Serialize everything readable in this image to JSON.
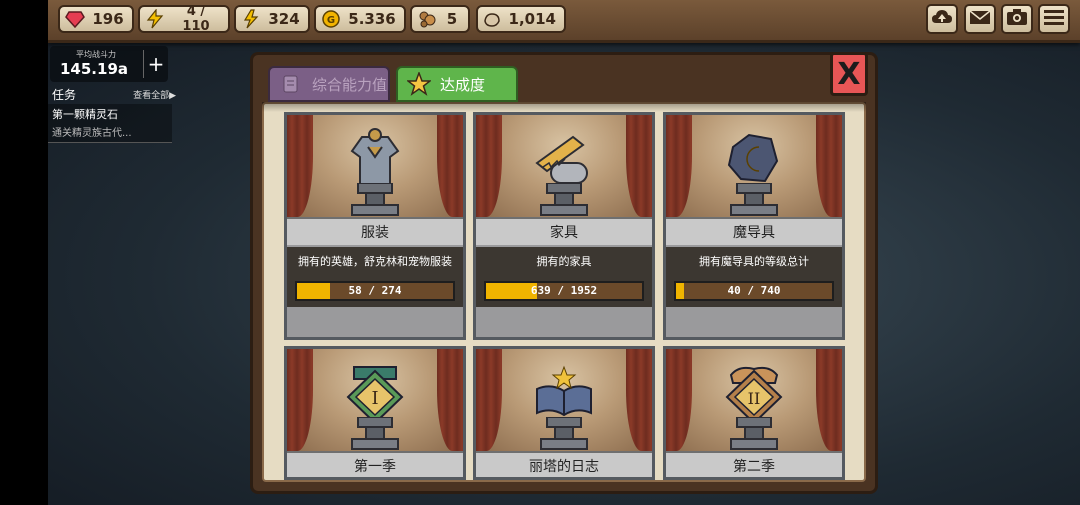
{
  "resources": {
    "gems": "196",
    "energy": "4 / 110",
    "stamina": "324",
    "gold": "5.336",
    "food": "5",
    "stone": "1,014"
  },
  "power": {
    "label": "平均战斗力",
    "value": "145.19a",
    "plus": "+"
  },
  "tasks": {
    "header": "任务",
    "view_all": "查看全部▶",
    "title": "第一颗精灵石",
    "desc": "通关精灵族古代..."
  },
  "tabs": {
    "stats": "综合能力值",
    "achievement": "达成度"
  },
  "close_label": "X",
  "cards": [
    {
      "title": "服装",
      "desc": "拥有的英雄，舒克林和宠物服装",
      "progress": "58 / 274",
      "ratio": 0.212
    },
    {
      "title": "家具",
      "desc": "拥有的家具",
      "progress": "639 / 1952",
      "ratio": 0.327
    },
    {
      "title": "魔导具",
      "desc": "拥有魔导具的等级总计",
      "progress": "40 / 740",
      "ratio": 0.054
    },
    {
      "title": "第一季"
    },
    {
      "title": "丽塔的日志"
    },
    {
      "title": "第二季"
    }
  ],
  "colors": {
    "progress_fill": "#f0b400",
    "tab_active": "#5fb54b",
    "close": "#e85656"
  },
  "icons": [
    "gem-icon",
    "lightning-icon",
    "stamina-icon",
    "gold-coin-icon",
    "food-icon",
    "stone-icon",
    "cloud-upload-icon",
    "mail-icon",
    "camera-icon",
    "menu-icon",
    "star-icon",
    "scroll-icon",
    "close-icon"
  ]
}
